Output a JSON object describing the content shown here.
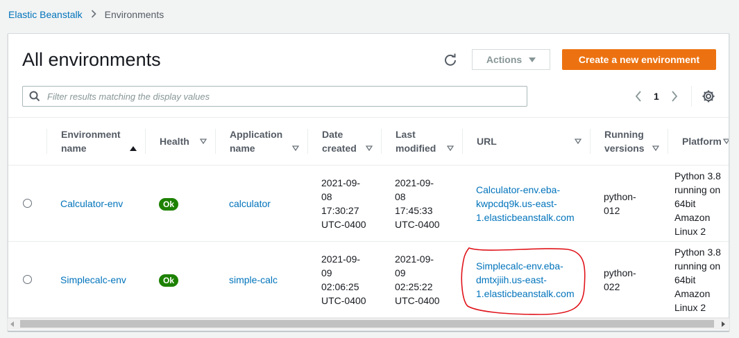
{
  "breadcrumb": {
    "root": "Elastic Beanstalk",
    "current": "Environments"
  },
  "page": {
    "title": "All environments"
  },
  "toolbar": {
    "actions_label": "Actions",
    "create_label": "Create a new environment"
  },
  "filter": {
    "placeholder": "Filter results matching the display values",
    "value": ""
  },
  "pagination": {
    "current_page": "1"
  },
  "columns": [
    {
      "line1": "Environment",
      "line2": "name",
      "sort": "ascending"
    },
    {
      "line1": "Health",
      "line2": "",
      "sort": "none"
    },
    {
      "line1": "Application",
      "line2": "name",
      "sort": "none"
    },
    {
      "line1": "Date",
      "line2": "created",
      "sort": "none"
    },
    {
      "line1": "Last",
      "line2": "modified",
      "sort": "none"
    },
    {
      "line1": "URL",
      "line2": "",
      "sort": "none"
    },
    {
      "line1": "Running",
      "line2": "versions",
      "sort": "none"
    },
    {
      "line1": "Platform",
      "line2": "",
      "sort": "none"
    }
  ],
  "rows": [
    {
      "env_name": "Calculator-env",
      "health": "Ok",
      "app_name": "calculator",
      "date_created": [
        "2021-09-",
        "08",
        "17:30:27",
        "UTC-0400"
      ],
      "last_modified": [
        "2021-09-",
        "08",
        "17:45:33",
        "UTC-0400"
      ],
      "url": [
        "Calculator-env.eba-",
        "kwpcdq9k.us-east-",
        "1.elasticbeanstalk.com"
      ],
      "running_versions": [
        "python-",
        "012"
      ],
      "platform": [
        "Python 3.8",
        "running on",
        "64bit",
        "Amazon",
        "Linux 2"
      ]
    },
    {
      "env_name": "Simplecalc-env",
      "health": "Ok",
      "app_name": "simple-calc",
      "date_created": [
        "2021-09-",
        "09",
        "02:06:25",
        "UTC-0400"
      ],
      "last_modified": [
        "2021-09-",
        "09",
        "02:25:22",
        "UTC-0400"
      ],
      "url": [
        "Simplecalc-env.eba-",
        "dmtxjiih.us-east-",
        "1.elasticbeanstalk.com"
      ],
      "running_versions": [
        "python-",
        "022"
      ],
      "platform": [
        "Python 3.8",
        "running on",
        "64bit",
        "Amazon",
        "Linux 2"
      ]
    }
  ],
  "colors": {
    "link": "#0073bb",
    "primary": "#ec7211",
    "ok": "#1d8102",
    "annotation": "#e0131a"
  },
  "icons": {
    "refresh": "refresh-icon",
    "search": "search-icon",
    "settings": "gear-icon",
    "prev": "chevron-left-icon",
    "next": "chevron-right-icon"
  }
}
